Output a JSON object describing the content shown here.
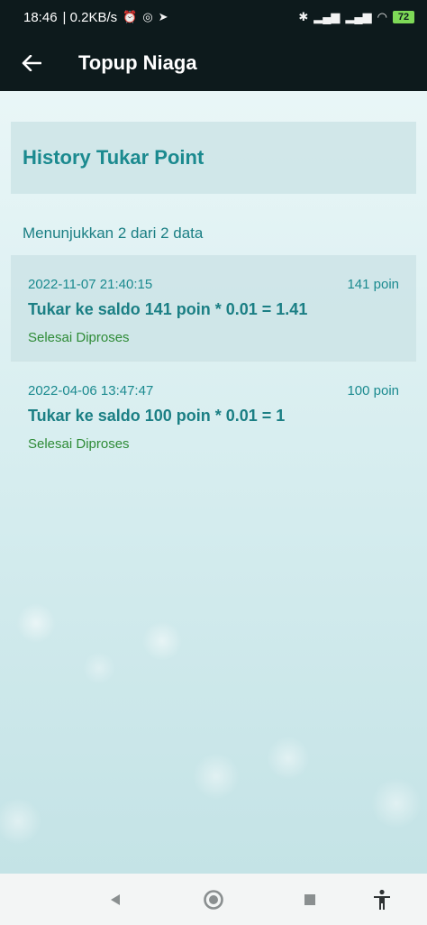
{
  "status_bar": {
    "time": "18:46",
    "speed": "| 0.2KB/s",
    "battery": "72"
  },
  "app_bar": {
    "title": "Topup Niaga",
    "back_icon": "arrow-left-icon"
  },
  "page": {
    "heading": "History Tukar Point",
    "summary": "Menunjukkan 2 dari 2 data"
  },
  "history": [
    {
      "date": "2022-11-07 21:40:15",
      "points": "141 poin",
      "title": "Tukar ke saldo 141 poin * 0.01 = 1.41",
      "status": "Selesai Diproses"
    },
    {
      "date": "2022-04-06 13:47:47",
      "points": "100 poin",
      "title": "Tukar ke saldo 100 poin * 0.01 = 1",
      "status": "Selesai Diproses"
    }
  ],
  "nav_bar": {
    "icons": [
      "back-triangle-icon",
      "home-circle-icon",
      "recents-square-icon",
      "accessibility-icon"
    ]
  },
  "colors": {
    "app_bar": "#0d1a1c",
    "accent": "#1b8a8f",
    "status_green": "#2e8b36"
  }
}
